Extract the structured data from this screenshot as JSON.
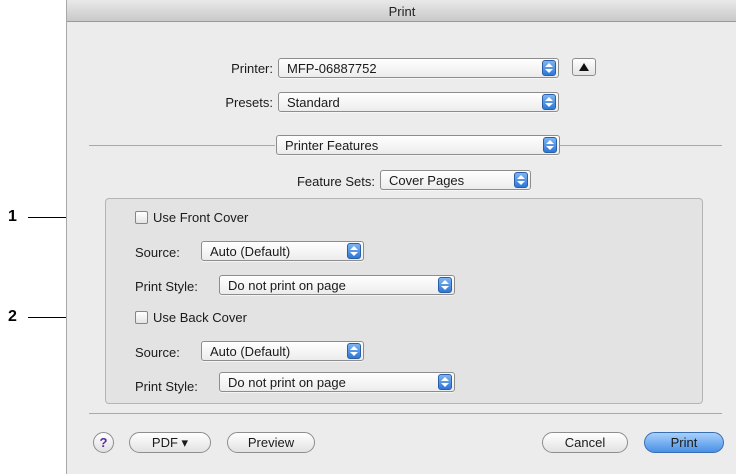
{
  "window": {
    "title": "Print"
  },
  "printer": {
    "label": "Printer:",
    "value": "MFP-06887752"
  },
  "presets": {
    "label": "Presets:",
    "value": "Standard"
  },
  "pane_selector": {
    "value": "Printer Features"
  },
  "feature_sets": {
    "label": "Feature Sets:",
    "value": "Cover Pages"
  },
  "front_cover": {
    "checkbox_label": "Use Front Cover",
    "checked": false,
    "source_label": "Source:",
    "source_value": "Auto (Default)",
    "print_style_label": "Print Style:",
    "print_style_value": "Do not print on page"
  },
  "back_cover": {
    "checkbox_label": "Use Back Cover",
    "checked": false,
    "source_label": "Source:",
    "source_value": "Auto (Default)",
    "print_style_label": "Print Style:",
    "print_style_value": "Do not print on page"
  },
  "callouts": {
    "one": "1",
    "two": "2"
  },
  "footer": {
    "help": "?",
    "pdf": "PDF ▾",
    "preview": "Preview",
    "cancel": "Cancel",
    "print": "Print"
  },
  "colors": {
    "accent": "#4a91e6",
    "window_bg": "#ececec"
  },
  "icons": {
    "popup_arrows": "updown-arrows-icon",
    "disclosure": "triangle-up-icon"
  }
}
